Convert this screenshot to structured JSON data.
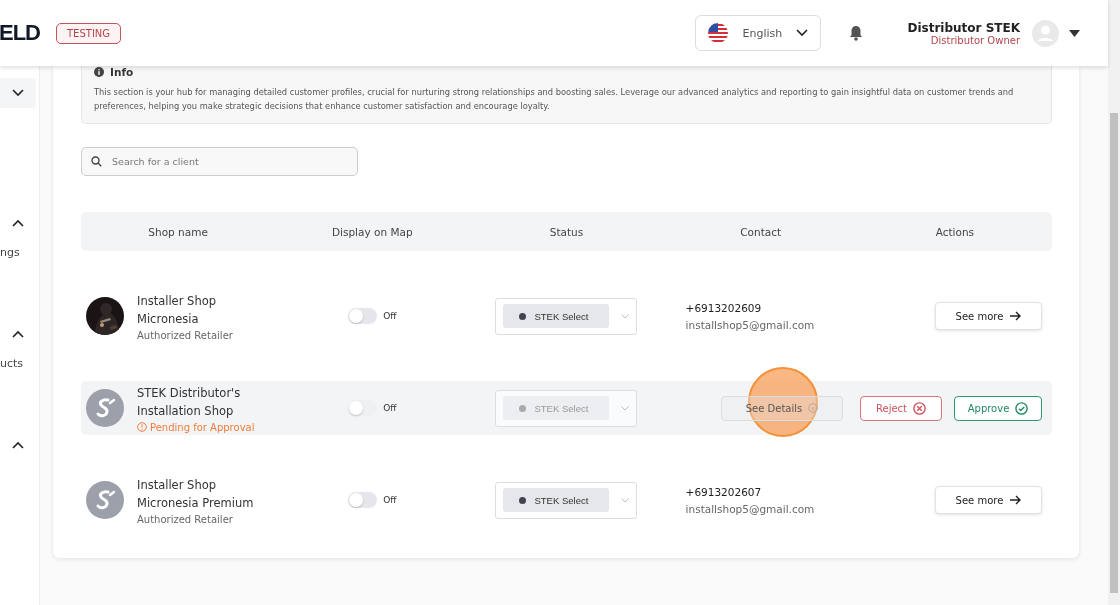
{
  "header": {
    "logo_text": "ELD",
    "badge": "TESTING",
    "language": "English",
    "user_name": "Distributor STEK",
    "user_role": "Distributor Owner"
  },
  "sidebar": {
    "groups": [
      {
        "expanded": false,
        "selected": true
      },
      {
        "expanded": true,
        "selected": false,
        "label": "ngs"
      },
      {
        "expanded": true,
        "selected": false,
        "label": "ucts"
      },
      {
        "expanded": true,
        "selected": false
      }
    ]
  },
  "info": {
    "title": "Info",
    "text": "This section is your hub for managing detailed customer profiles, crucial for nurturing strong relationships and boosting sales. Leverage our advanced analytics and reporting to gain insightful data on customer trends and preferences, helping you make strategic decisions that enhance customer satisfaction and encourage loyalty."
  },
  "search": {
    "placeholder": "Search for a client"
  },
  "table": {
    "columns": [
      "Shop name",
      "Display on Map",
      "Status",
      "Contact",
      "Actions"
    ],
    "rows": [
      {
        "kind": "active",
        "name": "Installer Shop Micronesia",
        "subtitle": "Authorized Retailer",
        "map_on": false,
        "map_label": "Off",
        "status": "STEK Select",
        "phone": "+6913202609",
        "email": "installshop5@gmail.com",
        "actions": [
          "See more"
        ],
        "click_marker": false
      },
      {
        "kind": "pending",
        "avatar": {
          "kind": "logo"
        },
        "name": "STEK Distributor's Installation Shop",
        "subtitle": "Pending for Approval",
        "map_on": false,
        "map_label": "Off",
        "status": "STEK Select",
        "actions": [
          "See Details",
          "Reject",
          "Approve"
        ],
        "click_marker": true
      },
      {
        "kind": "active",
        "avatar": {
          "kind": "logo"
        },
        "name": "Installer Shop Micronesia Premium",
        "subtitle": "Authorized Retailer",
        "map_on": false,
        "map_label": "Off",
        "status": "STEK Select",
        "phone": "+6913202607",
        "email": "installshop5@gmail.com",
        "actions": [
          "See more"
        ],
        "click_marker": false
      }
    ]
  }
}
